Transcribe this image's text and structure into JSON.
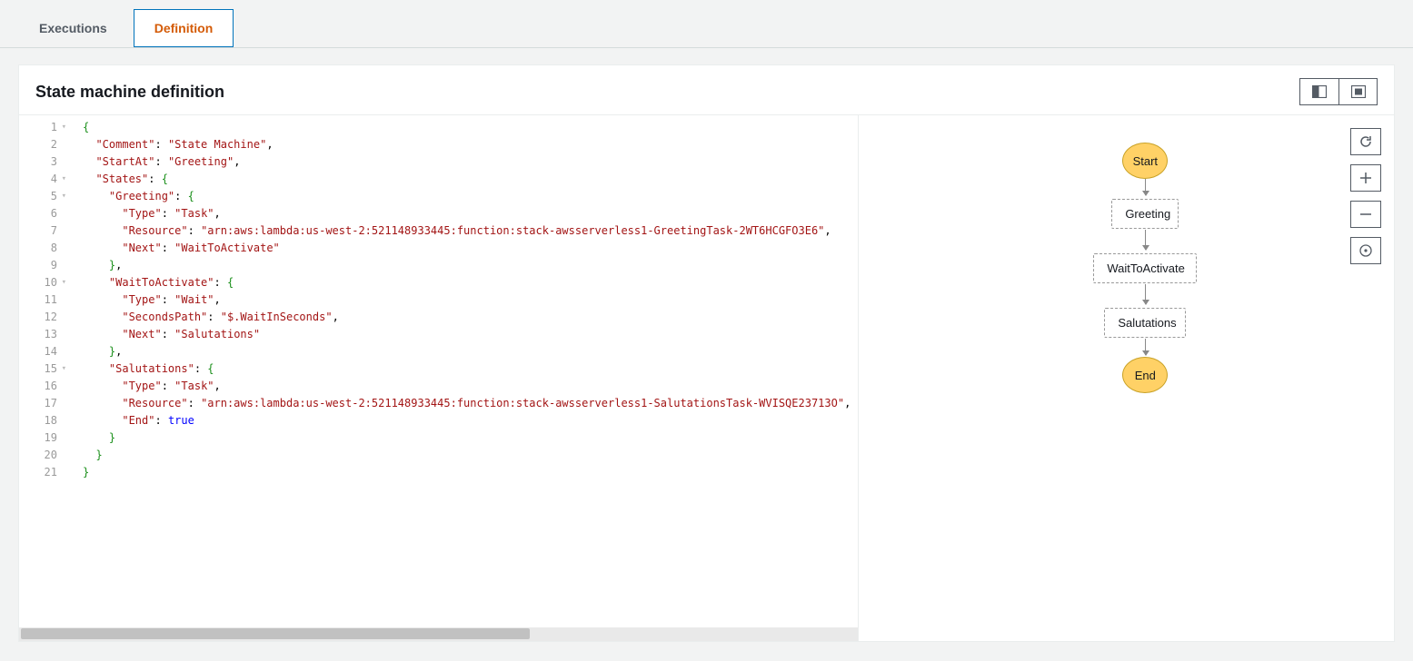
{
  "tabs": {
    "executions": "Executions",
    "definition": "Definition"
  },
  "panel": {
    "title": "State machine definition"
  },
  "code_lines": {
    "total": 21
  },
  "definition_json": {
    "Comment": "State Machine",
    "StartAt": "Greeting",
    "States": {
      "Greeting": {
        "Type": "Task",
        "Resource": "arn:aws:lambda:us-west-2:521148933445:function:stack-awsserverless1-GreetingTask-2WT6HCGFO3E6",
        "Next": "WaitToActivate"
      },
      "WaitToActivate": {
        "Type": "Wait",
        "SecondsPath": "$.WaitInSeconds",
        "Next": "Salutations"
      },
      "Salutations": {
        "Type": "Task",
        "Resource": "arn:aws:lambda:us-west-2:521148933445:function:stack-awsserverless1-SalutationsTask-WVISQE23713O",
        "End": true
      }
    }
  },
  "graph": {
    "start_label": "Start",
    "end_label": "End",
    "nodes": {
      "greeting": "Greeting",
      "wait": "WaitToActivate",
      "salutations": "Salutations"
    }
  },
  "icon_names": {
    "layout_split": "layout-split-icon",
    "layout_center": "layout-center-icon",
    "refresh": "refresh-icon",
    "zoom_in": "plus-icon",
    "zoom_out": "minus-icon",
    "center": "target-icon"
  }
}
